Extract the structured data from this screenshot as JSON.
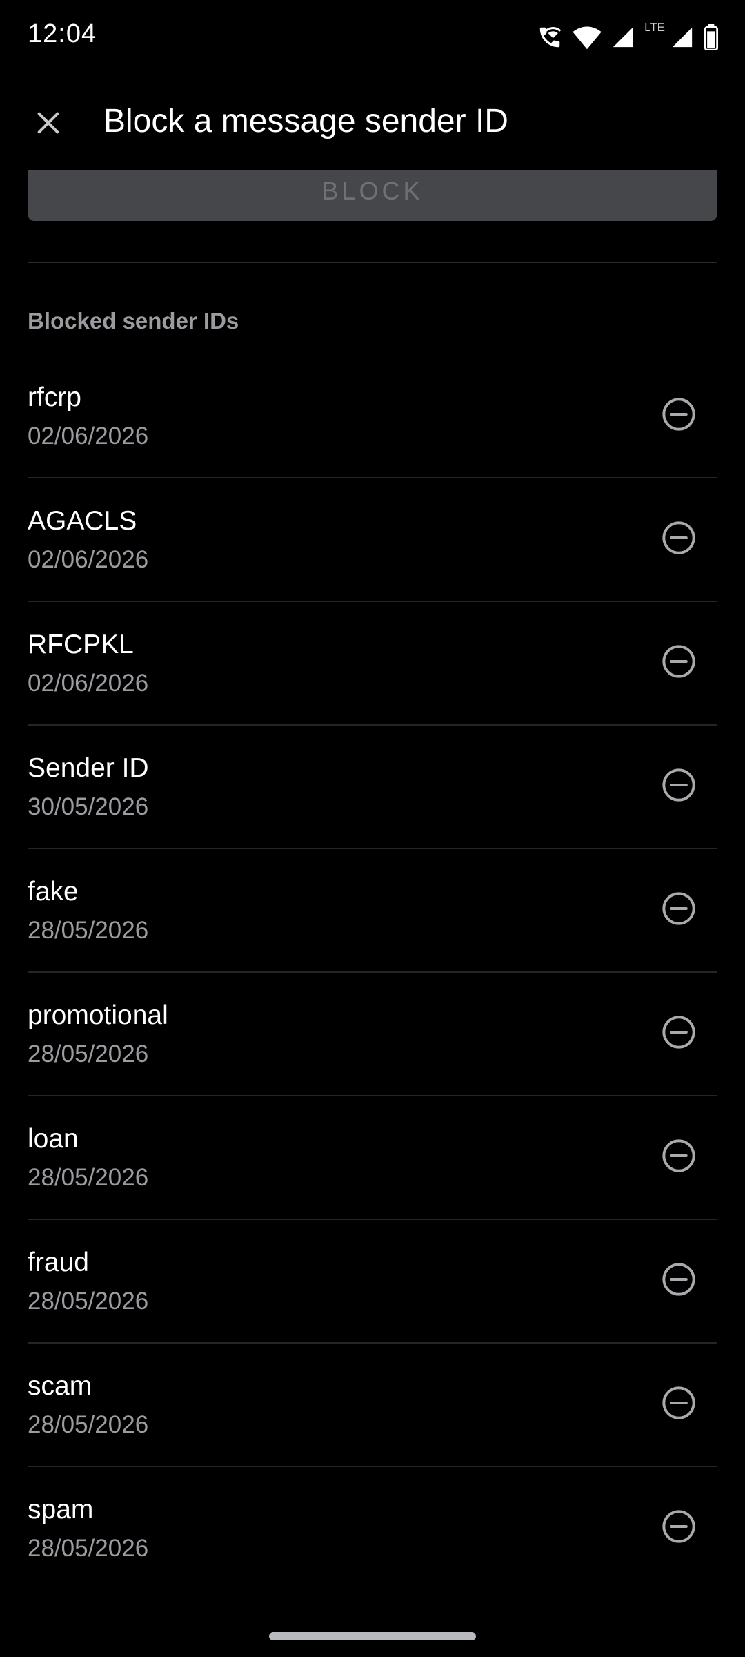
{
  "status_bar": {
    "time": "12:04",
    "lte_label": "LTE",
    "icons": [
      "wifi-calling-icon",
      "wifi-icon",
      "signal-icon",
      "signal-icon",
      "battery-icon"
    ]
  },
  "app_bar": {
    "close_icon": "close-icon",
    "title": "Block a message sender ID"
  },
  "block_button": {
    "label": "BLOCK"
  },
  "blocked_list": {
    "header": "Blocked sender IDs",
    "remove_icon": "minus-circle-icon",
    "items": [
      {
        "name": "rfcrp",
        "date": "02/06/2026"
      },
      {
        "name": "AGACLS",
        "date": "02/06/2026"
      },
      {
        "name": "RFCPKL",
        "date": "02/06/2026"
      },
      {
        "name": "Sender ID",
        "date": "30/05/2026"
      },
      {
        "name": "fake",
        "date": "28/05/2026"
      },
      {
        "name": "promotional",
        "date": "28/05/2026"
      },
      {
        "name": "loan",
        "date": "28/05/2026"
      },
      {
        "name": "fraud",
        "date": "28/05/2026"
      },
      {
        "name": "scam",
        "date": "28/05/2026"
      },
      {
        "name": "spam",
        "date": "28/05/2026"
      }
    ]
  },
  "colors": {
    "background": "#000000",
    "primary_text": "#ffffff",
    "secondary_text": "#9a9ca0",
    "disabled_button": "#45474b",
    "divider": "#242527"
  }
}
